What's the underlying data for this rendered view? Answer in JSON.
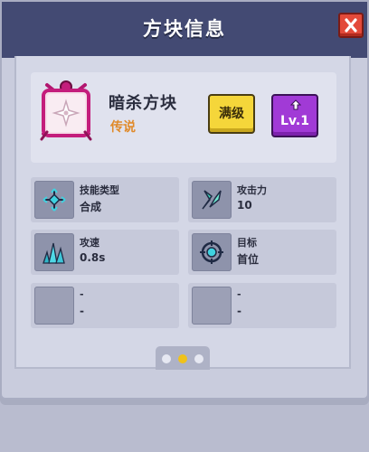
{
  "window": {
    "title": "方块信息"
  },
  "block": {
    "name": "暗杀方块",
    "rarity": "传说",
    "max_button": "满级",
    "level_button": "Lv.1"
  },
  "stats": [
    {
      "label": "技能类型",
      "value": "合成",
      "icon": "crossed-arrows-icon"
    },
    {
      "label": "攻击力",
      "value": "10",
      "icon": "crystal-leaf-icon"
    },
    {
      "label": "攻速",
      "value": "0.8s",
      "icon": "crystal-cluster-icon"
    },
    {
      "label": "目标",
      "value": "首位",
      "icon": "target-crosshair-icon"
    },
    {
      "label": "-",
      "value": "-",
      "icon": "empty-slot-icon"
    },
    {
      "label": "-",
      "value": "-",
      "icon": "empty-slot-icon"
    }
  ],
  "pager": {
    "page_count": 3,
    "active_page": 2
  },
  "colors": {
    "title_bar": "#434a73",
    "rarity_legendary": "#e08a2a",
    "max_button": "#f5d63a",
    "level_button": "#a13ad6",
    "close_button": "#e34a3a",
    "active_dot": "#f0c21a"
  }
}
